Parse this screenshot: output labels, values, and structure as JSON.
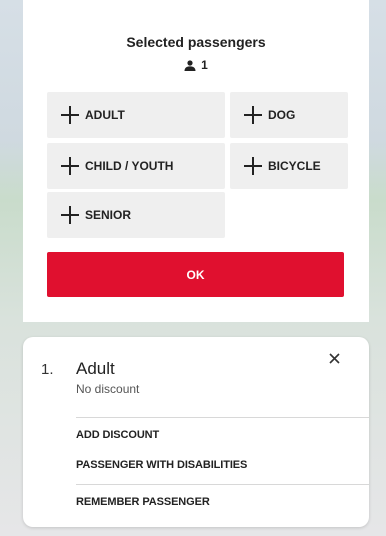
{
  "panel": {
    "title": "Selected passengers",
    "passenger_count": "1",
    "types": [
      {
        "label": "ADULT"
      },
      {
        "label": "DOG"
      },
      {
        "label": "CHILD / YOUTH"
      },
      {
        "label": "BICYCLE"
      },
      {
        "label": "SENIOR"
      }
    ],
    "ok_label": "OK"
  },
  "passenger_card": {
    "index": "1.",
    "name": "Adult",
    "discount": "No discount",
    "actions": [
      {
        "label": "ADD DISCOUNT"
      },
      {
        "label": "PASSENGER WITH DISABILITIES"
      },
      {
        "label": "REMEMBER PASSENGER"
      }
    ]
  },
  "colors": {
    "accent": "#e0102f",
    "button_bg": "#efefef"
  },
  "icons": {
    "count": "person-icon",
    "add": "plus-icon",
    "close": "close-icon"
  }
}
